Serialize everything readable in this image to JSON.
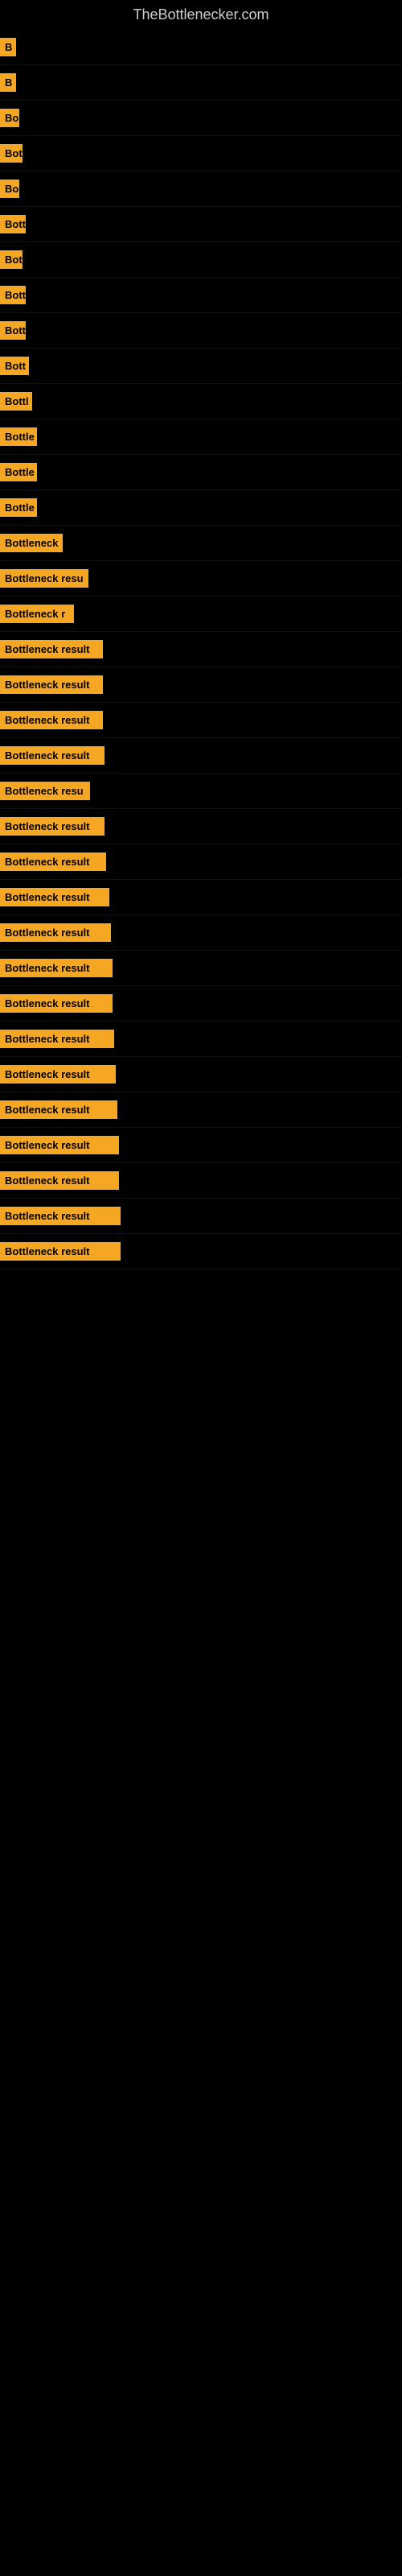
{
  "page": {
    "title": "TheBottlenecker.com",
    "background": "#000000",
    "accent_color": "#f5a623"
  },
  "rows": [
    {
      "id": 1,
      "label": "B",
      "label_width": 20
    },
    {
      "id": 2,
      "label": "B",
      "label_width": 20
    },
    {
      "id": 3,
      "label": "Bo",
      "label_width": 24
    },
    {
      "id": 4,
      "label": "Bot",
      "label_width": 28
    },
    {
      "id": 5,
      "label": "Bo",
      "label_width": 24
    },
    {
      "id": 6,
      "label": "Bott",
      "label_width": 32
    },
    {
      "id": 7,
      "label": "Bot",
      "label_width": 28
    },
    {
      "id": 8,
      "label": "Bott",
      "label_width": 32
    },
    {
      "id": 9,
      "label": "Bott",
      "label_width": 32
    },
    {
      "id": 10,
      "label": "Bott",
      "label_width": 36
    },
    {
      "id": 11,
      "label": "Bottl",
      "label_width": 40
    },
    {
      "id": 12,
      "label": "Bottle",
      "label_width": 46
    },
    {
      "id": 13,
      "label": "Bottle",
      "label_width": 46
    },
    {
      "id": 14,
      "label": "Bottle",
      "label_width": 46
    },
    {
      "id": 15,
      "label": "Bottleneck",
      "label_width": 78
    },
    {
      "id": 16,
      "label": "Bottleneck resu",
      "label_width": 110
    },
    {
      "id": 17,
      "label": "Bottleneck r",
      "label_width": 92
    },
    {
      "id": 18,
      "label": "Bottleneck result",
      "label_width": 128
    },
    {
      "id": 19,
      "label": "Bottleneck result",
      "label_width": 128
    },
    {
      "id": 20,
      "label": "Bottleneck result",
      "label_width": 128
    },
    {
      "id": 21,
      "label": "Bottleneck result",
      "label_width": 130
    },
    {
      "id": 22,
      "label": "Bottleneck resu",
      "label_width": 112
    },
    {
      "id": 23,
      "label": "Bottleneck result",
      "label_width": 130
    },
    {
      "id": 24,
      "label": "Bottleneck result",
      "label_width": 132
    },
    {
      "id": 25,
      "label": "Bottleneck result",
      "label_width": 136
    },
    {
      "id": 26,
      "label": "Bottleneck result",
      "label_width": 138
    },
    {
      "id": 27,
      "label": "Bottleneck result",
      "label_width": 140
    },
    {
      "id": 28,
      "label": "Bottleneck result",
      "label_width": 140
    },
    {
      "id": 29,
      "label": "Bottleneck result",
      "label_width": 142
    },
    {
      "id": 30,
      "label": "Bottleneck result",
      "label_width": 144
    },
    {
      "id": 31,
      "label": "Bottleneck result",
      "label_width": 146
    },
    {
      "id": 32,
      "label": "Bottleneck result",
      "label_width": 148
    },
    {
      "id": 33,
      "label": "Bottleneck result",
      "label_width": 148
    },
    {
      "id": 34,
      "label": "Bottleneck result",
      "label_width": 150
    },
    {
      "id": 35,
      "label": "Bottleneck result",
      "label_width": 150
    }
  ]
}
